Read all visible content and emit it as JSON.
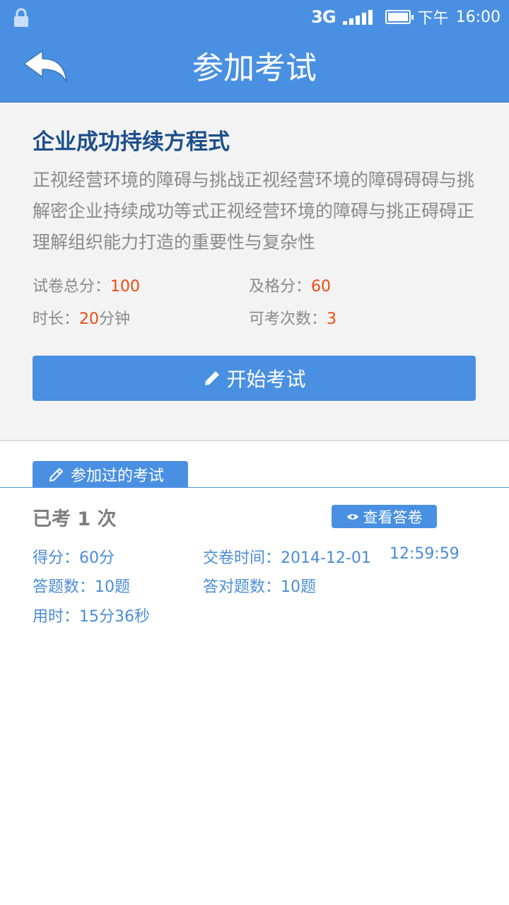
{
  "status_bar": {
    "network": "3G",
    "period": "下午",
    "time": "16:00"
  },
  "header": {
    "title": "参加考试"
  },
  "exam": {
    "title": "企业成功持续方程式",
    "description": "正视经营环境的障碍与挑战正视经营环境的障碍碍碍与挑\n解密企业持续成功等式正视经营环境的障碍与挑正碍碍正\n理解组织能力打造的重要性与复杂性",
    "total_score_label": "试卷总分：",
    "total_score_value": "100",
    "pass_score_label": "及格分：",
    "pass_score_value": "60",
    "duration_label": "时长：",
    "duration_value": "20",
    "duration_unit": "分钟",
    "attempts_label": "可考次数：",
    "attempts_value": "3",
    "start_button_label": "开始考试"
  },
  "history": {
    "tab_label": "参加过的考试",
    "attempt_count_text": "已考 1 次",
    "view_answer_label": "查看答卷",
    "score": "得分：60分",
    "submit_time_label": "交卷时间：2014-12-01",
    "submit_time_clock": "12:59:59",
    "question_count": "答题数：10题",
    "correct_count": "答对题数：10题",
    "time_used": "用时：15分36秒"
  },
  "colors": {
    "primary": "#4a90e2",
    "title_text": "#1d4f8c",
    "highlight": "#ee4a12",
    "muted_text": "#8a8a8a",
    "result_text": "#4a8cd6"
  },
  "icons": {
    "status_lock": "lock-icon",
    "back": "back-arrow-icon",
    "start": "pencil-icon",
    "tab": "pencil-outline-icon",
    "view": "eye-icon"
  }
}
